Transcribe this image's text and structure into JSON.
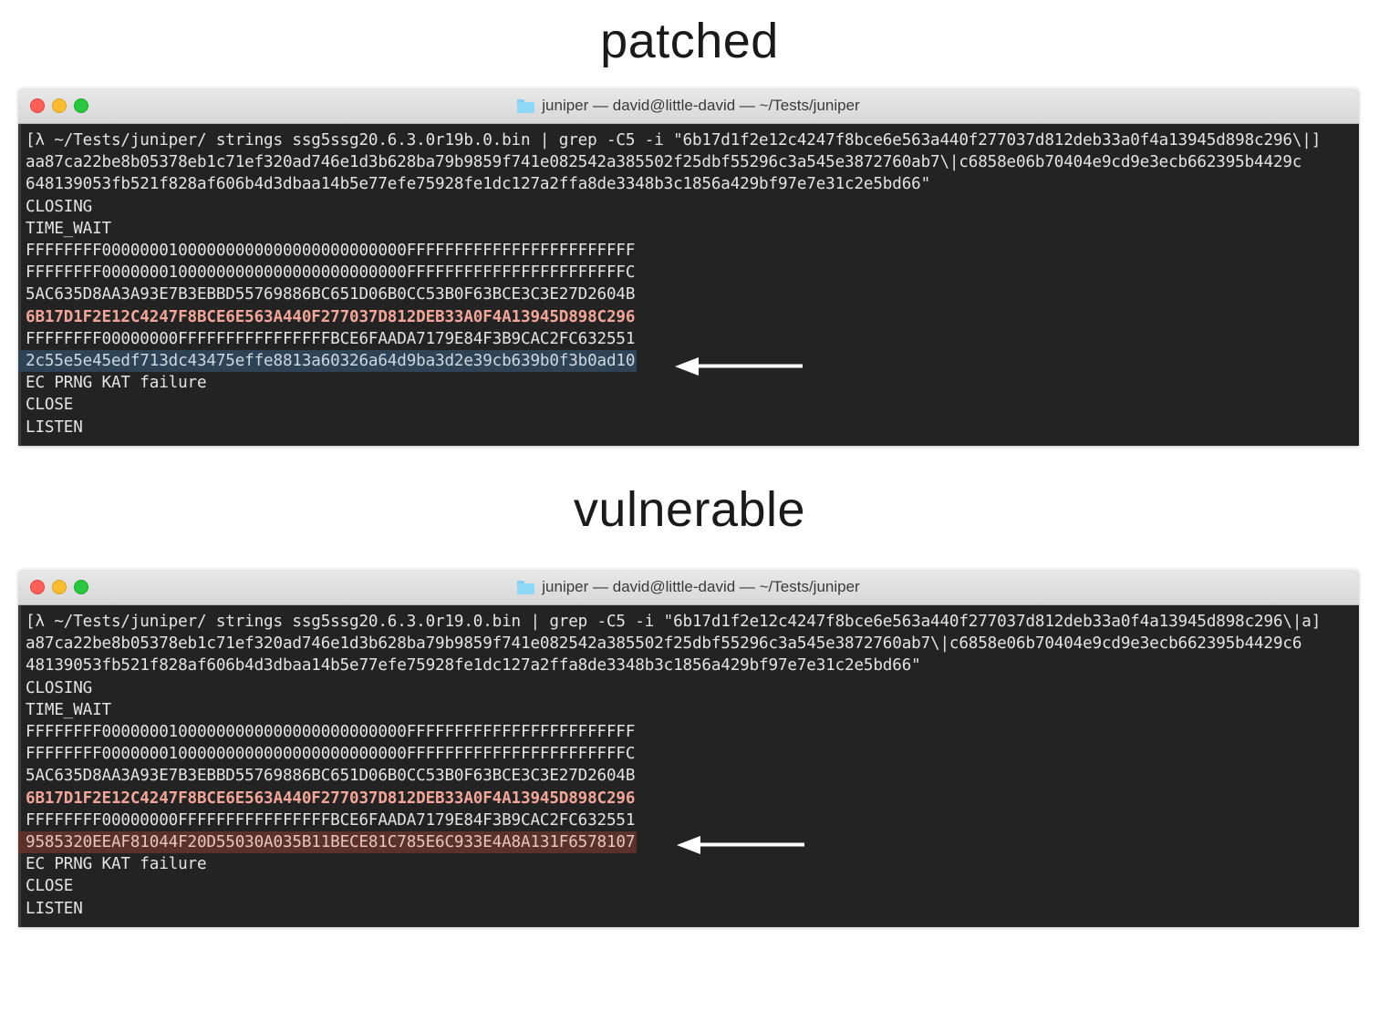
{
  "headings": {
    "patched": "patched",
    "vulnerable": "vulnerable"
  },
  "colors": {
    "terminal_background": "#232323",
    "terminal_foreground": "#e4e4e4",
    "match_highlight_text": "#f3a697",
    "patched_row_background": "#2f4356",
    "vulnerable_row_background": "#5b322b",
    "traffic_close": "#ff5f57",
    "traffic_minimize": "#febc2e",
    "traffic_zoom": "#28c840",
    "arrow": "#ffffff"
  },
  "windows": [
    {
      "id": "patched",
      "title": "juniper — david@little-david — ~/Tests/juniper",
      "folder_icon": "folder-icon",
      "traffic_lights": [
        "close-button",
        "minimize-button",
        "zoom-button"
      ],
      "lines": [
        {
          "text": "[λ ~/Tests/juniper/ strings ssg5ssg20.6.3.0r19b.0.bin | grep -C5 -i \"6b17d1f2e12c4247f8bce6e563a440f277037d812deb33a0f4a13945d898c296\\|]",
          "style": "normal"
        },
        {
          "text": "aa87ca22be8b05378eb1c71ef320ad746e1d3b628ba79b9859f741e082542a385502f25dbf55296c3a545e3872760ab7\\|c6858e06b70404e9cd9e3ecb662395b4429c",
          "style": "normal"
        },
        {
          "text": "648139053fb521f828af606b4d3dbaa14b5e77efe75928fe1dc127a2ffa8de3348b3c1856a429bf97e7e31c2e5bd66\"",
          "style": "normal"
        },
        {
          "text": "CLOSING",
          "style": "normal"
        },
        {
          "text": "TIME_WAIT",
          "style": "normal"
        },
        {
          "text": "FFFFFFFF00000001000000000000000000000000FFFFFFFFFFFFFFFFFFFFFFFF",
          "style": "normal"
        },
        {
          "text": "FFFFFFFF00000001000000000000000000000000FFFFFFFFFFFFFFFFFFFFFFFC",
          "style": "normal"
        },
        {
          "text": "5AC635D8AA3A93E7B3EBBD55769886BC651D06B0CC53B0F63BCE3C3E27D2604B",
          "style": "normal"
        },
        {
          "text": "6B17D1F2E12C4247F8BCE6E563A440F277037D812DEB33A0F4A13945D898C296",
          "style": "pink"
        },
        {
          "text": "FFFFFFFF00000000FFFFFFFFFFFFFFFFBCE6FAADA7179E84F3B9CAC2FC632551",
          "style": "normal"
        },
        {
          "text": "2c55e5e45edf713dc43475effe8813a60326a64d9ba3d2e39cb639b0f3b0ad10",
          "style": "highlight-blue"
        },
        {
          "text": "EC PRNG KAT failure",
          "style": "normal"
        },
        {
          "text": "CLOSE",
          "style": "normal"
        },
        {
          "text": "LISTEN",
          "style": "normal"
        }
      ]
    },
    {
      "id": "vulnerable",
      "title": "juniper — david@little-david — ~/Tests/juniper",
      "folder_icon": "folder-icon",
      "traffic_lights": [
        "close-button",
        "minimize-button",
        "zoom-button"
      ],
      "lines": [
        {
          "text": "[λ ~/Tests/juniper/ strings ssg5ssg20.6.3.0r19.0.bin | grep -C5 -i \"6b17d1f2e12c4247f8bce6e563a440f277037d812deb33a0f4a13945d898c296\\|a]",
          "style": "normal"
        },
        {
          "text": "a87ca22be8b05378eb1c71ef320ad746e1d3b628ba79b9859f741e082542a385502f25dbf55296c3a545e3872760ab7\\|c6858e06b70404e9cd9e3ecb662395b4429c6",
          "style": "normal"
        },
        {
          "text": "48139053fb521f828af606b4d3dbaa14b5e77efe75928fe1dc127a2ffa8de3348b3c1856a429bf97e7e31c2e5bd66\"",
          "style": "normal"
        },
        {
          "text": "CLOSING",
          "style": "normal"
        },
        {
          "text": "TIME_WAIT",
          "style": "normal"
        },
        {
          "text": "FFFFFFFF00000001000000000000000000000000FFFFFFFFFFFFFFFFFFFFFFFF",
          "style": "normal"
        },
        {
          "text": "FFFFFFFF00000001000000000000000000000000FFFFFFFFFFFFFFFFFFFFFFFC",
          "style": "normal"
        },
        {
          "text": "5AC635D8AA3A93E7B3EBBD55769886BC651D06B0CC53B0F63BCE3C3E27D2604B",
          "style": "normal"
        },
        {
          "text": "6B17D1F2E12C4247F8BCE6E563A440F277037D812DEB33A0F4A13945D898C296",
          "style": "pink"
        },
        {
          "text": "FFFFFFFF00000000FFFFFFFFFFFFFFFFBCE6FAADA7179E84F3B9CAC2FC632551",
          "style": "normal"
        },
        {
          "text": "9585320EEAF81044F20D55030A035B11BECE81C785E6C933E4A8A131F6578107",
          "style": "highlight-red"
        },
        {
          "text": "EC PRNG KAT failure",
          "style": "normal"
        },
        {
          "text": "CLOSE",
          "style": "normal"
        },
        {
          "text": "LISTEN",
          "style": "normal"
        }
      ]
    }
  ]
}
